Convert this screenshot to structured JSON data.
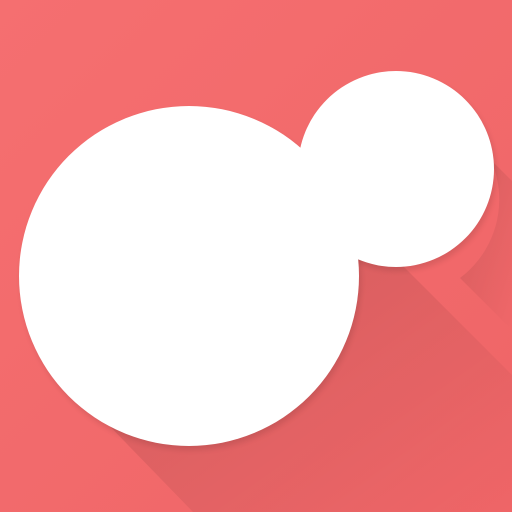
{
  "icon": {
    "name": "bubbles-icon",
    "colors": {
      "background": "#f26b6d",
      "foreground": "#ffffff",
      "long_shadow": "#d95558"
    }
  }
}
